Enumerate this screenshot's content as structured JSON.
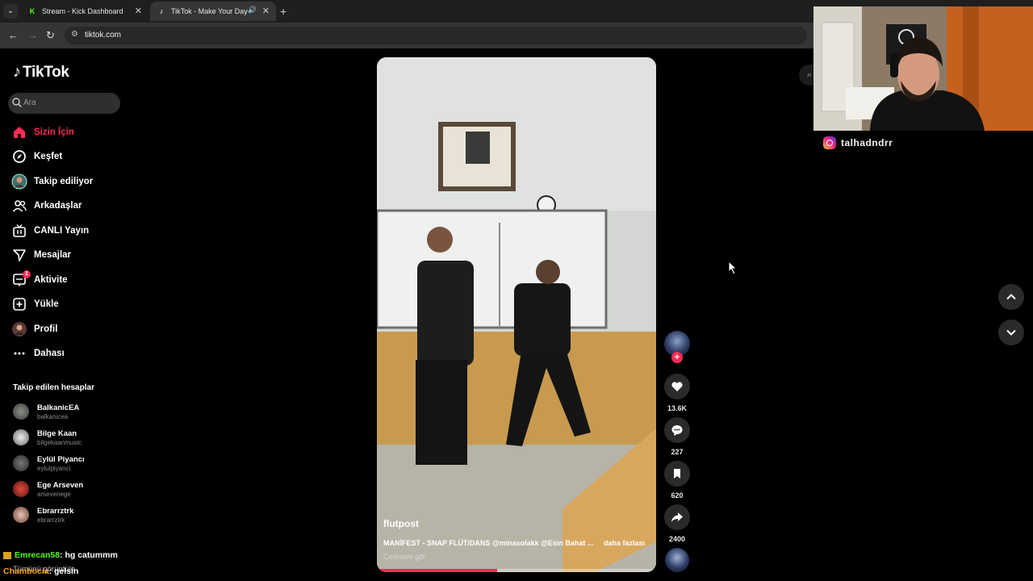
{
  "browser": {
    "tabs": [
      {
        "title": "Stream - Kick Dashboard",
        "favicon": "kick-icon",
        "active": false
      },
      {
        "title": "TikTok - Make Your Day",
        "favicon": "tiktok-icon",
        "active": true
      }
    ],
    "url": "tiktok.com"
  },
  "sidebar": {
    "logo_text": "TikTok",
    "search_placeholder": "Ara",
    "nav": [
      {
        "label": "Sizin İçin",
        "icon": "home-icon",
        "active": true
      },
      {
        "label": "Keşfet",
        "icon": "compass-icon"
      },
      {
        "label": "Takip ediliyor",
        "icon": "following-avatar"
      },
      {
        "label": "Arkadaşlar",
        "icon": "friends-icon"
      },
      {
        "label": "CANLI Yayın",
        "icon": "live-tv-icon"
      },
      {
        "label": "Mesajlar",
        "icon": "send-icon"
      },
      {
        "label": "Aktivite",
        "icon": "activity-icon",
        "badge": "1"
      },
      {
        "label": "Yükle",
        "icon": "upload-plus-icon"
      },
      {
        "label": "Profil",
        "icon": "profile-avatar"
      },
      {
        "label": "Dahası",
        "icon": "more-dots-icon"
      }
    ],
    "following_title": "Takip edilen hesaplar",
    "following": [
      {
        "name": "BalkanicEA",
        "handle": "balkanicea"
      },
      {
        "name": "Bilge Kaan",
        "handle": "bilgekaanmusic"
      },
      {
        "name": "Eylül Piyancı",
        "handle": "eylulpiyanci"
      },
      {
        "name": "Ege Arseven",
        "handle": "arsevenege"
      },
      {
        "name": "Ebrarrztrk",
        "handle": "ebrarrztrk"
      }
    ],
    "see_all": "Tümünü görüntüle"
  },
  "chat": [
    {
      "user": "Emrecan58",
      "message": ": hg catummm"
    },
    {
      "user": "Chambocia",
      "message": ": gelsin"
    }
  ],
  "video": {
    "author": "flutpost",
    "caption": "MANİFEST - SNAP FLÜT/DANS @minasolakk @Esin Bahat ...",
    "more": "daha fazlası",
    "translate": "Çevirisini gör",
    "progress": 0.43
  },
  "actions": {
    "likes": "13.6K",
    "comments": "227",
    "saves": "620",
    "shares": "2400"
  },
  "streamer": {
    "instagram": "talhadndrr"
  },
  "colors": {
    "accent": "#fe2c55",
    "kick_green": "#53fc18"
  }
}
